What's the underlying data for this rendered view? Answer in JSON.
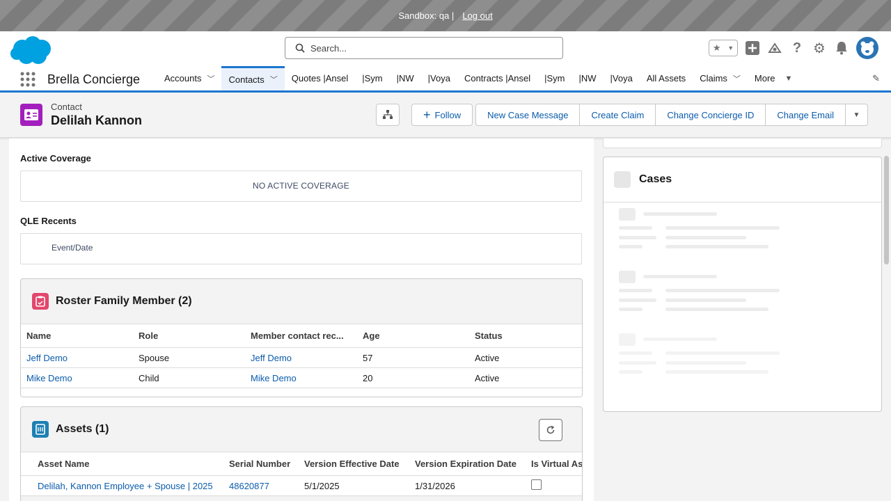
{
  "sandbox": {
    "label": "Sandbox: qa |",
    "logout": "Log out"
  },
  "search": {
    "placeholder": "Search..."
  },
  "app": {
    "name": "Brella Concierge"
  },
  "nav": {
    "tabs": [
      {
        "label": "Accounts",
        "chevron": true
      },
      {
        "label": "Contacts",
        "chevron": true,
        "active": true
      },
      {
        "label": "Quotes |Ansel"
      },
      {
        "label": "|Sym"
      },
      {
        "label": "|NW"
      },
      {
        "label": "|Voya"
      },
      {
        "label": "Contracts |Ansel"
      },
      {
        "label": "|Sym"
      },
      {
        "label": "|NW"
      },
      {
        "label": "|Voya"
      },
      {
        "label": "All Assets"
      },
      {
        "label": "Claims",
        "chevron": true
      },
      {
        "label": "More",
        "caret": true
      }
    ]
  },
  "record": {
    "type": "Contact",
    "name": "Delilah Kannon",
    "follow": "Follow",
    "actions": [
      "New Case Message",
      "Create Claim",
      "Change Concierge ID",
      "Change Email"
    ]
  },
  "active_coverage": {
    "title": "Active Coverage",
    "empty": "NO ACTIVE COVERAGE"
  },
  "qle": {
    "title": "QLE Recents",
    "column": "Event/Date"
  },
  "roster": {
    "title": "Roster Family Member (2)",
    "columns": [
      "Name",
      "Role",
      "Member contact rec...",
      "Age",
      "Status"
    ],
    "rows": [
      [
        "Jeff Demo",
        "Spouse",
        "Jeff Demo",
        "57",
        "Active"
      ],
      [
        "Mike Demo",
        "Child",
        "Mike Demo",
        "20",
        "Active"
      ]
    ]
  },
  "assets": {
    "title": "Assets (1)",
    "columns": [
      "Asset Name",
      "Serial Number",
      "Version Effective Date",
      "Version Expiration Date",
      "Is Virtual As"
    ],
    "rows": [
      [
        "Delilah, Kannon Employee + Spouse | 2025",
        "48620877",
        "5/1/2025",
        "1/31/2026",
        ""
      ]
    ]
  },
  "cases": {
    "title": "Cases"
  },
  "colors": {
    "brand": "#1b75d0",
    "link": "#0b5cab",
    "contact_icon": "#a31fbd",
    "roster_icon": "#e3476c",
    "assets_icon": "#1e80b3"
  }
}
